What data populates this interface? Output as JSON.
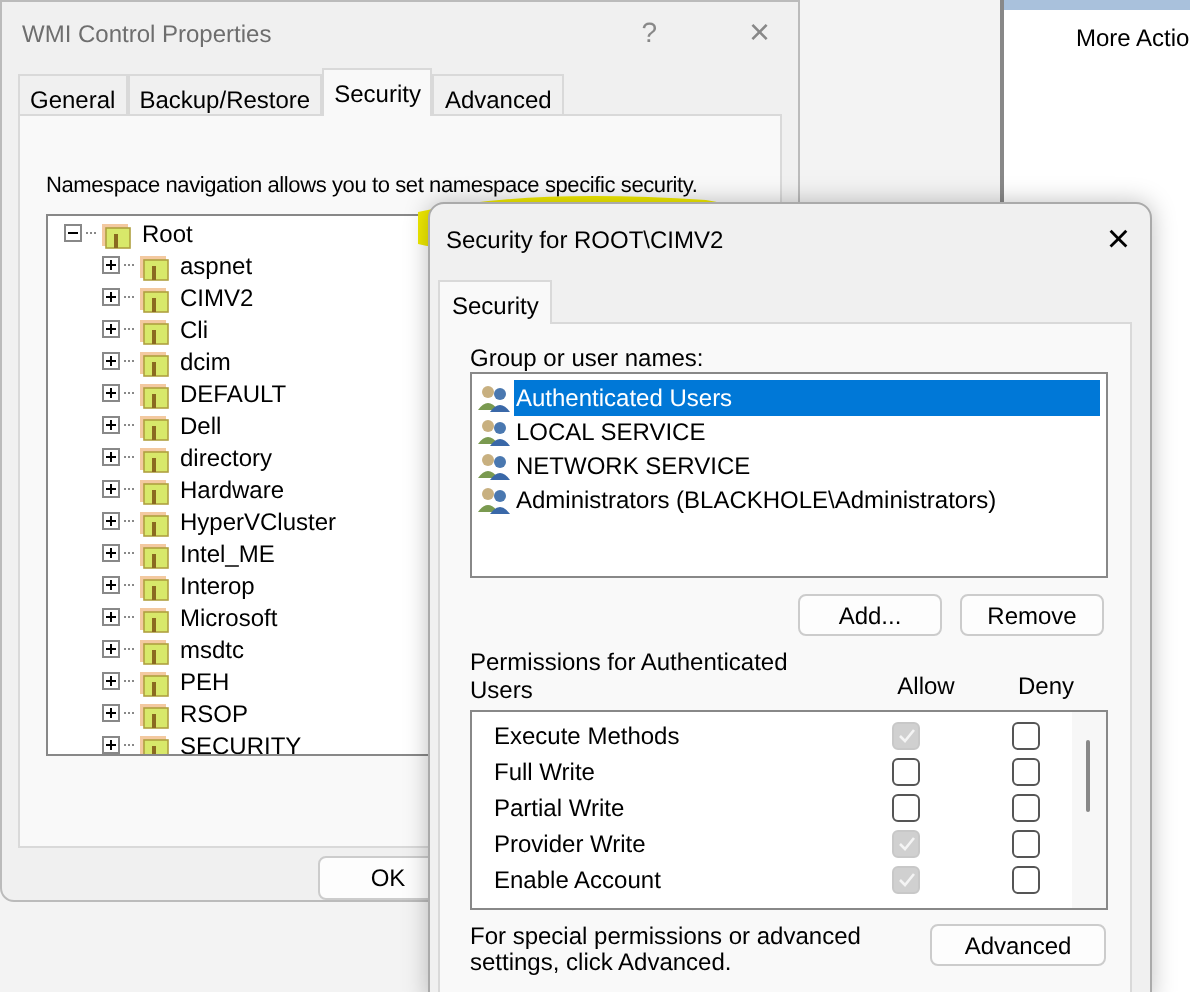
{
  "background_window": {
    "title": "More Actio"
  },
  "wmi_window": {
    "title": "WMI Control Properties",
    "help": "?",
    "close": "×",
    "tabs": [
      {
        "label": "General",
        "selected": false
      },
      {
        "label": "Backup/Restore",
        "selected": false
      },
      {
        "label": "Security",
        "selected": true
      },
      {
        "label": "Advanced",
        "selected": false
      }
    ],
    "description": "Namespace navigation allows you to set namespace specific security.",
    "tree": [
      {
        "label": "Root",
        "expanded": true,
        "children": [
          {
            "label": "aspnet",
            "expanded": false
          },
          {
            "label": "CIMV2",
            "expanded": false
          },
          {
            "label": "Cli",
            "expanded": false
          },
          {
            "label": "dcim",
            "expanded": false
          },
          {
            "label": "DEFAULT",
            "expanded": false
          },
          {
            "label": "Dell",
            "expanded": false
          },
          {
            "label": "directory",
            "expanded": false
          },
          {
            "label": "Hardware",
            "expanded": false
          },
          {
            "label": "HyperVCluster",
            "expanded": false
          },
          {
            "label": "Intel_ME",
            "expanded": false
          },
          {
            "label": "Interop",
            "expanded": false
          },
          {
            "label": "Microsoft",
            "expanded": false
          },
          {
            "label": "msdtc",
            "expanded": false
          },
          {
            "label": "PEH",
            "expanded": false
          },
          {
            "label": "RSOP",
            "expanded": false
          },
          {
            "label": "SECURITY",
            "expanded": false
          }
        ]
      }
    ],
    "ok_button": "OK"
  },
  "security_dialog": {
    "title": "Security for ROOT\\CIMV2",
    "close": "×",
    "tabs": [
      {
        "label": "Security",
        "selected": true
      }
    ],
    "users_label": "Group or user names:",
    "users": [
      {
        "name": "Authenticated Users",
        "selected": true
      },
      {
        "name": "LOCAL SERVICE",
        "selected": false
      },
      {
        "name": "NETWORK SERVICE",
        "selected": false
      },
      {
        "name": "Administrators (BLACKHOLE\\Administrators)",
        "selected": false
      }
    ],
    "buttons": [
      "Add...",
      "Remove"
    ],
    "permissions_label": "Permissions for Authenticated Users",
    "columns": [
      "Allow",
      "Deny"
    ],
    "permissions": [
      {
        "name": "Execute Methods",
        "allow": true,
        "allow_disabled": true,
        "deny": false
      },
      {
        "name": "Full Write",
        "allow": false,
        "allow_disabled": false,
        "deny": false
      },
      {
        "name": "Partial Write",
        "allow": false,
        "allow_disabled": false,
        "deny": false
      },
      {
        "name": "Provider Write",
        "allow": true,
        "allow_disabled": true,
        "deny": false
      },
      {
        "name": "Enable Account",
        "allow": true,
        "allow_disabled": true,
        "deny": false
      }
    ],
    "advanced_note": "For special permissions or advanced settings, click Advanced.",
    "advanced_button": "Advanced"
  }
}
